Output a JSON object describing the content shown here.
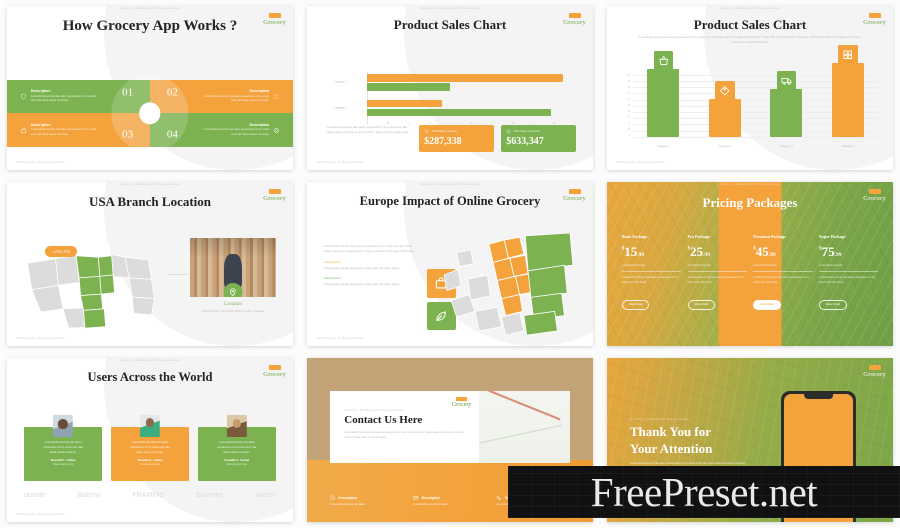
{
  "brand": {
    "name": "Grocery",
    "green": "#7cb350",
    "orange": "#f3a23c"
  },
  "watermark": {
    "text": "FreePreset.net"
  },
  "common": {
    "footer": "©2020 Grocery. All Rights Reserved.",
    "eyebrow": "Grocery Powerpoint Presentation",
    "lorem_short": "A wonderful serenity has taken possession of my entire soul, like these sweet mornings of spring which I enjoy with my whole heart.",
    "lorem_long": "A wonderful serenity has taken possession of my entire soul, like these sweet mornings of spring which I enjoy with my whole heart. I am alone, and feel the charm of existence in this spot, which was created for the bliss.",
    "description_label": "Description"
  },
  "slides": [
    {
      "id": "how-it-works",
      "title": "How Grocery App Works ?",
      "quadrants": [
        {
          "number": "01",
          "color": "green",
          "side": "left",
          "icon": "shield-icon",
          "head": "Description",
          "body": "A wonderful serenity has taken possession of my entire soul, like these sweet mornings."
        },
        {
          "number": "02",
          "color": "orange",
          "side": "right",
          "icon": "tools-icon",
          "head": "Description",
          "body": "A wonderful serenity has taken possession of my entire soul, like these sweet mornings."
        },
        {
          "number": "03",
          "color": "orange",
          "side": "left",
          "icon": "bag-icon",
          "head": "Description",
          "body": "A wonderful serenity has taken possession of my entire soul, like these sweet mornings."
        },
        {
          "number": "04",
          "color": "green",
          "side": "right",
          "icon": "support-icon",
          "head": "Description",
          "body": "A wonderful serenity has taken possession of my entire soul, like these sweet mornings."
        }
      ]
    },
    {
      "id": "sales-chart-bar-h",
      "title": "Product Sales Chart",
      "kpis": [
        {
          "color": "orange",
          "icon": "cart-icon",
          "label": "Total Sales in Europe",
          "value": "$287,338"
        },
        {
          "color": "green",
          "icon": "basket-icon",
          "label": "Total Sales in America",
          "value": "$633,347"
        }
      ]
    },
    {
      "id": "sales-chart-bar-v",
      "title": "Product Sales Chart"
    },
    {
      "id": "usa-branch",
      "title": "USA Branch Location",
      "badge": "+256,392",
      "location_title": "Location",
      "location_address": "15 Bond Street, Surry Hills, NSW 2 Sydney, Australia"
    },
    {
      "id": "europe-impact",
      "title": "Europe Impact of Online Grocery",
      "intro": "A wonderful serenity has taken possession of my entire soul, like these sweet mornings of spring which I enjoy existence in this spot, which was",
      "items": [
        {
          "head": "Description",
          "color": "orange",
          "icon": "box-icon",
          "body": "A wonderful serenity possession entire soul, like these sweet"
        },
        {
          "head": "Description",
          "color": "green",
          "icon": "leaf-icon",
          "body": "A wonderful serenity possession entire soul, like these sweet"
        }
      ]
    },
    {
      "id": "pricing",
      "title": "Pricing Packages",
      "packages": [
        {
          "name": "Basic Package",
          "currency": "$",
          "integer": "15",
          "decimal": ".99",
          "note": "A wonderful serenity",
          "desc": "A wonderful serenity has taken possession of my entire soul, like these.",
          "button": "More Detail",
          "featured": false
        },
        {
          "name": "Pro Package",
          "currency": "$",
          "integer": "25",
          "decimal": ".99",
          "note": "A wonderful serenity",
          "desc": "A wonderful serenity has taken possession of my entire soul, like these.",
          "button": "More Detail",
          "featured": false
        },
        {
          "name": "Premium Package",
          "currency": "$",
          "integer": "45",
          "decimal": ".99",
          "note": "A wonderful serenity",
          "desc": "A wonderful serenity has taken possession of my entire soul, like these.",
          "button": "More Detail",
          "featured": true
        },
        {
          "name": "Super Package",
          "currency": "$",
          "integer": "75",
          "decimal": ".99",
          "note": "A wonderful serenity",
          "desc": "A wonderful serenity has taken possession of my entire soul, like these.",
          "button": "More Detail",
          "featured": false
        }
      ]
    },
    {
      "id": "users-world",
      "title": "Users Across the World",
      "testimonials": [
        {
          "color": "green",
          "quote": "A wonderful serenity has taken possession of my entire soul, like these sweet mornings.",
          "name": "Donald S. Satine",
          "role": "Director Apps Corp",
          "avatar": "avatar-woman"
        },
        {
          "color": "orange",
          "quote": "A wonderful serenity has taken possession of my entire soul, like these sweet mornings.",
          "name": "Donald S. Satine",
          "role": "Director Apps Corp",
          "avatar": "avatar-man"
        },
        {
          "color": "green",
          "quote": "A wonderful serenity has taken possession of my entire soul, like these sweet mornings.",
          "name": "Donald S. Satine",
          "role": "Director Apps Corp",
          "avatar": "avatar-woman-2"
        }
      ],
      "logos": [
        "donate",
        "Bakzrvi",
        "FRAME•S",
        "Examine",
        "Vaccin"
      ]
    },
    {
      "id": "contact",
      "title": "Contact Us Here",
      "body": "A wonderful serenity has taken possession of my entire soul, like these sweet mornings of spring which I enjoy with my whole heart.",
      "items": [
        {
          "icon": "clock-icon",
          "head": "Description",
          "body": "A wonderful serenity has taken"
        },
        {
          "icon": "mail-icon",
          "head": "Description",
          "body": "A wonderful serenity has taken"
        },
        {
          "icon": "phone-icon",
          "head": "Description",
          "body": "A wonderful serenity has taken"
        }
      ]
    },
    {
      "id": "thank-you",
      "title_line1": "Thank You for",
      "title_line2": "Your Attention",
      "body": "A wonderful serenity has taken possession of my entire soul, like these sweet mornings of spring which I enjoy with my whole heart.",
      "phone_button": "Open"
    }
  ],
  "chart_data": [
    {
      "type": "bar",
      "orientation": "horizontal",
      "title": "Product Sales Chart",
      "slide": "sales-chart-bar-h",
      "categories": [
        "Category 2",
        "Category 1"
      ],
      "series": [
        {
          "name": "Orange Series",
          "color": "#f3a23c",
          "values": [
            47,
            18
          ]
        },
        {
          "name": "Green Series",
          "color": "#7cb350",
          "values": [
            20,
            44
          ]
        }
      ],
      "xticks": [
        "0",
        "05",
        "1",
        "15",
        "2",
        "25",
        "3",
        "35",
        "4",
        "45",
        "5"
      ],
      "xlim": [
        0,
        50
      ],
      "grid": false,
      "legend": "none"
    },
    {
      "type": "bar",
      "orientation": "vertical",
      "title": "Product Sales Chart",
      "slide": "sales-chart-bar-v",
      "categories": [
        "Category 1",
        "Category 2",
        "Category 3",
        "Category 4"
      ],
      "values": [
        44,
        26,
        32,
        48
      ],
      "colors": [
        "#7cb350",
        "#f3a23c",
        "#7cb350",
        "#f3a23c"
      ],
      "bar_icons": [
        "basket-icon",
        "tag-icon",
        "delivery-icon",
        "grid-icon"
      ],
      "yticks": [
        "0",
        "05",
        "10",
        "15",
        "20",
        "25",
        "30",
        "35",
        "40",
        "45",
        "50"
      ],
      "ylim": [
        0,
        50
      ],
      "grid": true,
      "legend": "none"
    }
  ]
}
